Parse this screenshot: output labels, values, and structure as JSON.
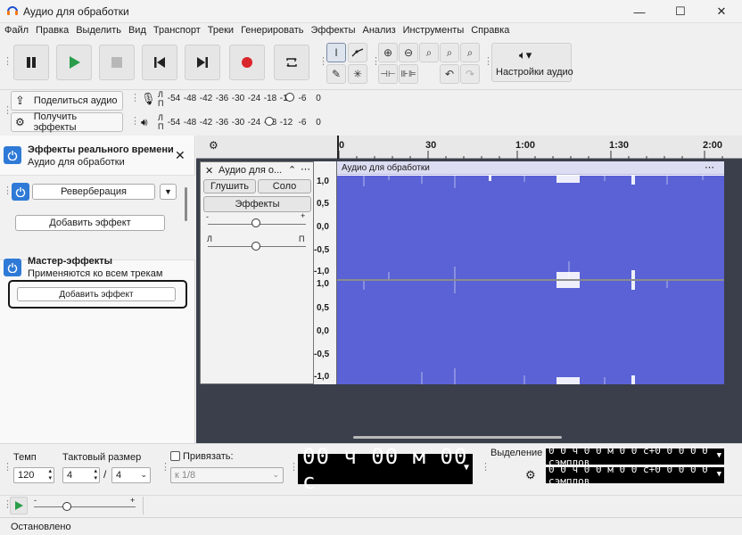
{
  "window": {
    "title": "Аудио для обработки",
    "minimize": "—",
    "maximize": "☐",
    "close": "✕"
  },
  "menu": [
    "Файл",
    "Правка",
    "Выделить",
    "Вид",
    "Транспорт",
    "Треки",
    "Генерировать",
    "Эффекты",
    "Анализ",
    "Инструменты",
    "Справка"
  ],
  "toolbar": {
    "audio_setup_label": "Настройки аудио",
    "share_audio_label": "Поделиться аудио",
    "get_effects_label": "Получить эффекты",
    "meter_ticks": [
      "-54",
      "-48",
      "-42",
      "-36",
      "-30",
      "-24",
      "-18",
      "-12",
      "-6",
      "0"
    ],
    "play_meter_ticks": [
      "-54",
      "-48",
      "-42",
      "-36",
      "-30",
      "-24",
      "-18",
      "-12",
      "-6",
      "0"
    ],
    "channel_l": "Л",
    "channel_r": "П"
  },
  "realtime_effects": {
    "title": "Эффекты реального времени",
    "subtitle": "Аудио для обработки",
    "effect_name": "Реверберация",
    "add_effect_label": "Добавить эффект"
  },
  "master_effects": {
    "title": "Мастер-эффекты",
    "subtitle": "Применяются ко всем трекам",
    "add_effect_label": "Добавить эффект"
  },
  "ruler": {
    "ticks": [
      "0",
      "30",
      "1:00",
      "1:30",
      "2:00"
    ]
  },
  "track": {
    "name": "Аудио для о...",
    "clip_name": "Аудио для обработки",
    "mute_label": "Глушить",
    "solo_label": "Соло",
    "effects_label": "Эффекты",
    "gain_minus": "-",
    "gain_plus": "+",
    "pan_left": "Л",
    "pan_right": "П",
    "scale_top": [
      "1,0",
      "0,5",
      "0,0",
      "-0,5",
      "-1,0"
    ],
    "scale_bottom": [
      "1,0",
      "0,5",
      "0,0",
      "-0,5",
      "-1,0"
    ]
  },
  "bottom": {
    "tempo_label": "Темп",
    "tempo_value": "120",
    "time_sig_label": "Тактовый размер",
    "time_sig_num": "4",
    "time_sig_den": "4",
    "time_sig_sep": "/",
    "snap_label": "Привязать:",
    "snap_value": "к 1/8",
    "time_display": "00 ч 00 м 00 с",
    "selection_label": "Выделение",
    "selection_start": "0 0 ч 0 0 м 0 0 с+0 0 0 0 0 сэмплов",
    "selection_end": "0 0 ч 0 0 м 0 0 с+0 0 0 0 0 сэмплов",
    "speed_minus": "-",
    "speed_plus": "+"
  },
  "status": {
    "text": "Остановлено"
  },
  "colors": {
    "waveform": "#5a62d6",
    "accent": "#2f7ad7",
    "record": "#d9262c",
    "play": "#2a9d4a"
  }
}
